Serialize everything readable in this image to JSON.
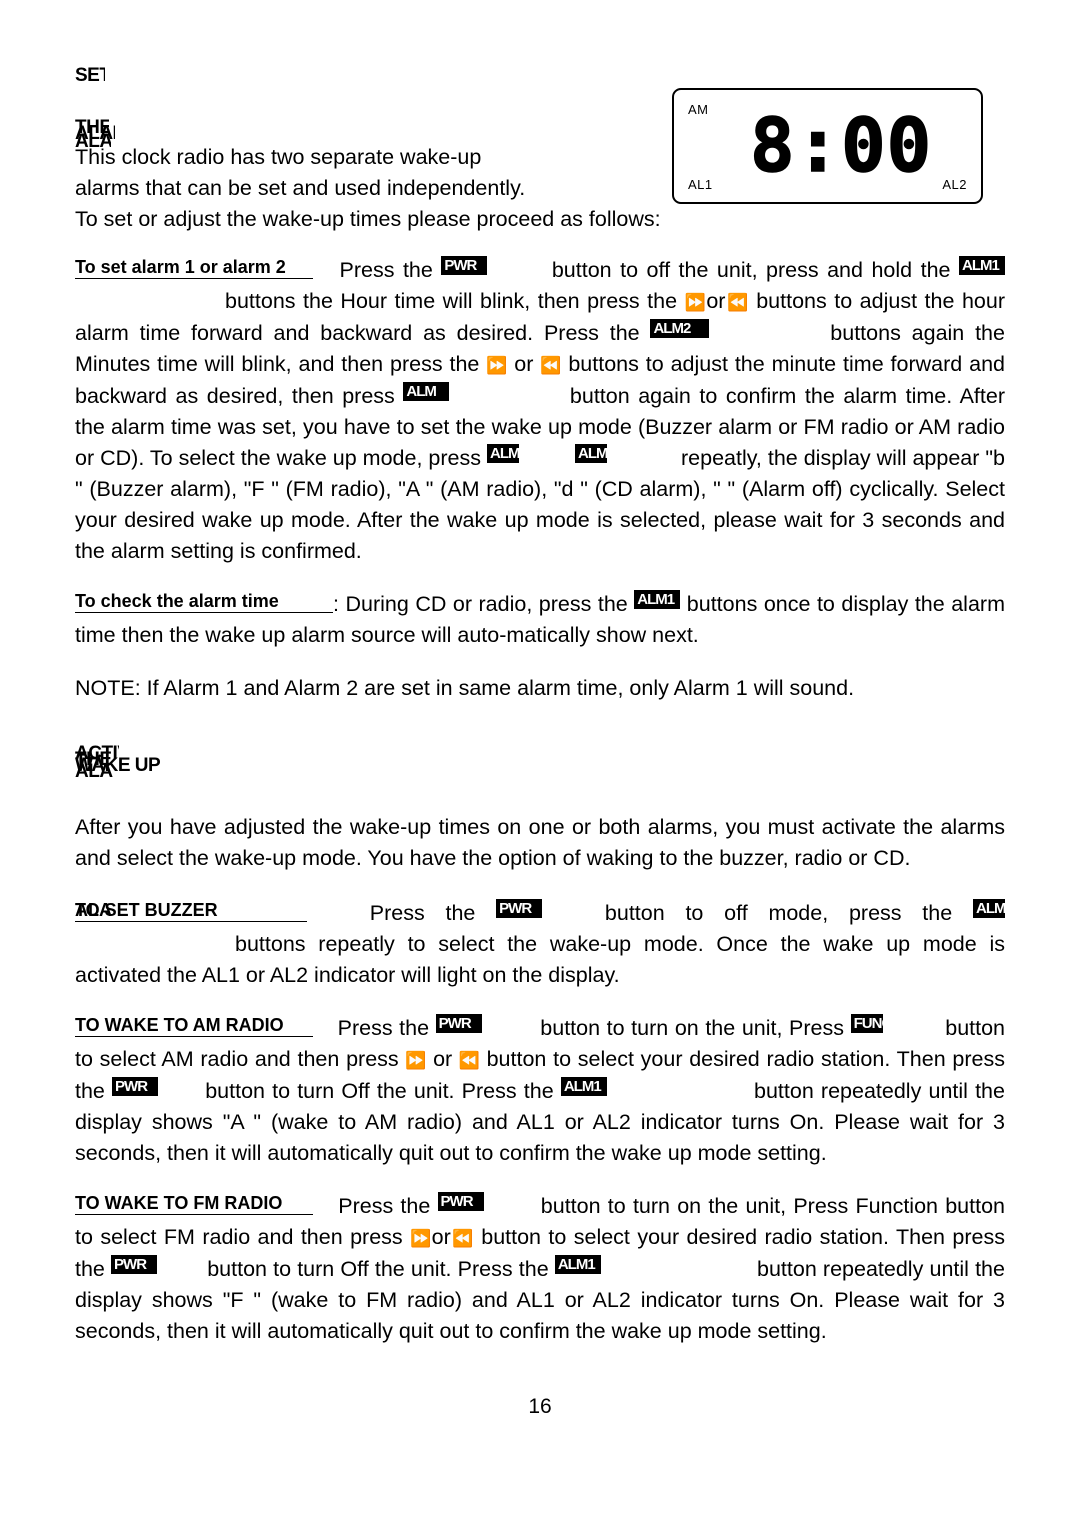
{
  "page": {
    "number": "16",
    "lcd": {
      "am_indicator": "AM",
      "al1_indicator": "AL1",
      "al2_indicator": "AL2",
      "time": "8:00"
    },
    "headings": {
      "alarm_section": [
        "SETTING",
        "THE WAKE",
        "ALARM TIME",
        "ALARM"
      ],
      "wake_section": [
        "ACTIVATING",
        "THE ALARM",
        "WAKE UP MODE",
        "ALARM"
      ]
    },
    "paragraphs": {
      "intro_1": "This clock radio has two separate wake-up",
      "intro_2": "alarms that can be set and used independently.",
      "intro_3": "To set or adjust the wake-up times please proceed as follows:",
      "set_label": "To set alarm 1 or alarm 2",
      "set_1a": "Press the",
      "set_1b": "button to off the unit, press and hold",
      "set_2a": "the",
      "set_2b": "buttons the Hour time will blink, then press the",
      "set_3a": "or",
      "set_3b": "buttons to adjust the hour alarm time forward and backward as desired.",
      "set_4a": "Press the",
      "set_4b": "buttons again the Minutes time will blink,",
      "set_5": "and then press the",
      "set_5b": "or",
      "set_5c": "buttons to adjust the minute time forward and",
      "set_6a": "backward as desired, then press",
      "set_6b": "button again to confirm",
      "set_7": "the alarm time. After the alarm time was set, you have to set the wake up mode (Buzzer alarm or FM radio or AM radio or CD). To select the wake up mode, press",
      "set_7b": "repeatly, the display will appear \"b \" (Buzzer alarm), \"F \" (FM radio), \"A \" (AM radio), \"d \" (CD alarm), \"  \" (Alarm off) cyclically. Select your desired wake up mode. After the wake up mode is selected, please wait for 3 seconds and the alarm setting is confirmed.",
      "check_label": "To check the alarm time",
      "check_a": ": During CD or radio, press the",
      "check_b": "buttons once to display the alarm time then the wake up alarm source will auto-matically show next.",
      "note": "NOTE: If Alarm 1 and Alarm 2 are set in same alarm time, only Alarm 1 will sound.",
      "activate_1": "After you have adjusted the wake-up times on one or both alarms, you must activate the alarms and select the wake-up mode. You have the option of waking to the buzzer, radio or CD.",
      "buzzer_label_a": "TO SET BUZZER",
      "buzzer_label_b": "ALARM",
      "buzzer_a": "Press the",
      "buzzer_b": "button to off mode, press the",
      "buzzer_c": "buttons repeatly to select the wake-up mode. Once the wake up mode is activated the AL1 or AL2 indicator will light on the display.",
      "am_label": "TO WAKE TO AM RADIO",
      "am_a": "Press the",
      "am_b": "button to turn on the unit, Press",
      "am_c": "button to select AM radio and then press",
      "am_d": "or",
      "am_e": "button to select your desired radio station. Then press the",
      "am_f": "button to turn Off the unit. Press the",
      "am_g": "button repeatedly until the display shows \"A \" (wake to AM radio) and AL1 or AL2 indicator turns On. Please wait for 3 seconds, then it will automatically quit out to confirm the wake up mode setting.",
      "fm_label": "TO WAKE TO FM RADIO",
      "fm_a": "Press the",
      "fm_b": "button to turn on the unit, Press Function button to select FM radio and then press",
      "fm_c": "or",
      "fm_d": "button to select your desired radio station. Then press the",
      "fm_e": "button to turn Off the unit. Press the",
      "fm_f": "button repeatedly until the display shows \"F \" (wake to FM radio) and AL1 or AL2 indicator turns On. Please wait for 3 seconds, then it will automatically quit out to confirm the wake up mode setting."
    },
    "buttons": {
      "power": "PWR",
      "alarm": "ALM",
      "alm1": "ALM1",
      "alm2": "ALM2",
      "func": "FUNC",
      "fwd_icon": "skip-forward",
      "rew_icon": "skip-backward"
    }
  }
}
